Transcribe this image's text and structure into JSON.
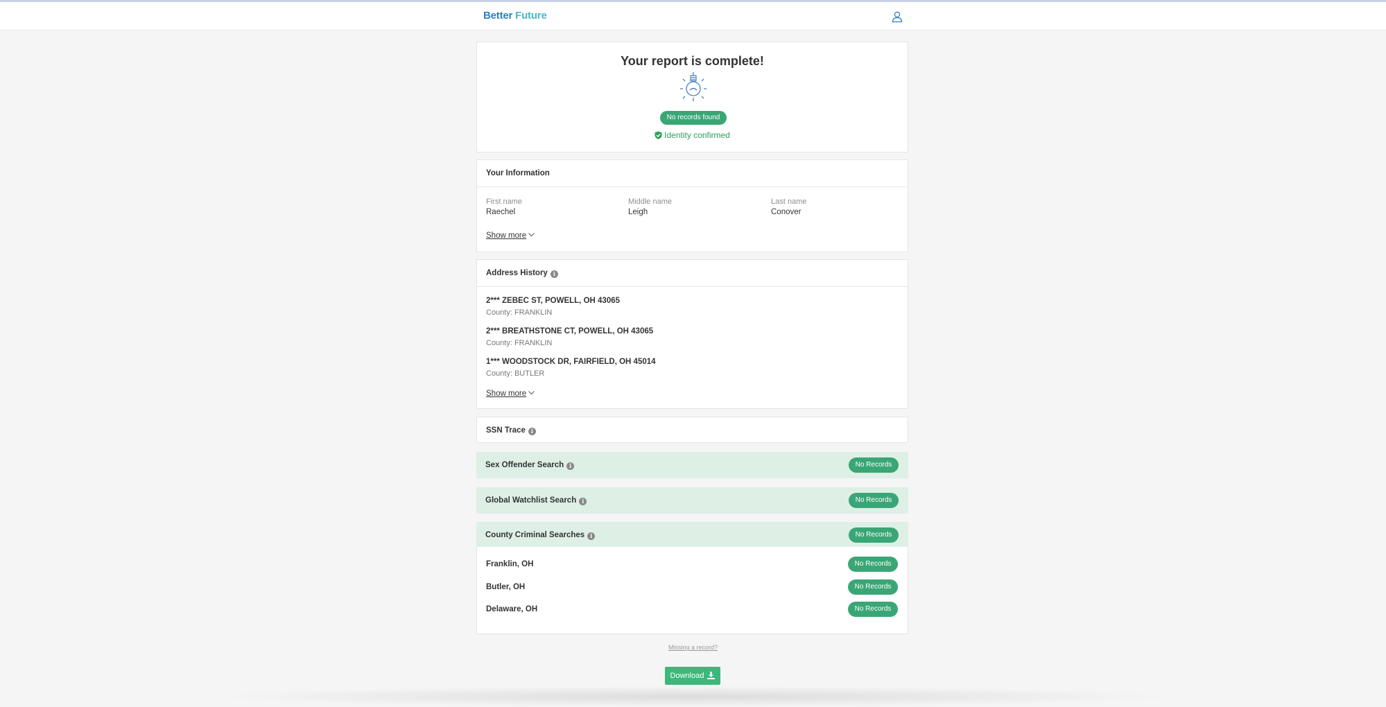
{
  "brand": {
    "word1": "Better",
    "word2": "Future"
  },
  "report": {
    "title": "Your report is complete!",
    "status_pill": "No records found",
    "identity_text": "Identity confirmed"
  },
  "your_information": {
    "heading": "Your Information",
    "fields": [
      {
        "label": "First name",
        "value": "Raechel"
      },
      {
        "label": "Middle name",
        "value": "Leigh"
      },
      {
        "label": "Last name",
        "value": "Conover"
      }
    ],
    "show_more": "Show more"
  },
  "address_history": {
    "heading": "Address History",
    "addresses": [
      {
        "street": "2*** ZEBEC ST, POWELL, OH 43065",
        "county": "County: FRANKLIN"
      },
      {
        "street": "2*** BREATHSTONE CT, POWELL, OH 43065",
        "county": "County: FRANKLIN"
      },
      {
        "street": "1*** WOODSTOCK DR, FAIRFIELD, OH 45014",
        "county": "County: BUTLER"
      }
    ],
    "show_more": "Show more"
  },
  "ssn_trace": {
    "heading": "SSN Trace"
  },
  "searches": [
    {
      "name": "Sex Offender Search",
      "status": "No Records"
    },
    {
      "name": "Global Watchlist Search",
      "status": "No Records"
    },
    {
      "name": "County Criminal Searches",
      "status": "No Records"
    }
  ],
  "county_results": [
    {
      "name": "Franklin, OH",
      "status": "No Records"
    },
    {
      "name": "Butler, OH",
      "status": "No Records"
    },
    {
      "name": "Delaware, OH",
      "status": "No Records"
    }
  ],
  "missing_record_link": "Missing a record?",
  "download_label": "Download",
  "colors": {
    "accent_green": "#3aa676",
    "brand_blue": "#2d7fbf",
    "brand_teal": "#49b7c4",
    "row_green_bg": "#deefe6"
  },
  "icons": {
    "user": "user-icon",
    "bulb": "lightbulb-icon",
    "check": "shield-check-icon",
    "info": "info-icon",
    "download": "download-icon"
  }
}
